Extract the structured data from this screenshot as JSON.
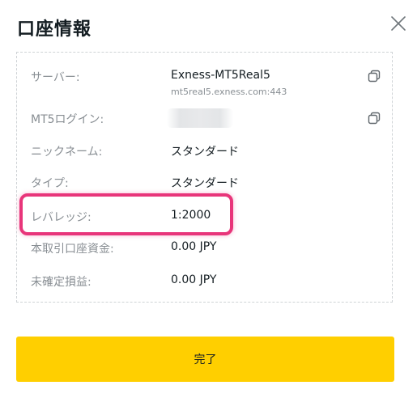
{
  "dialog": {
    "title": "口座情報",
    "close_icon": "close-icon"
  },
  "rows": [
    {
      "label": "サーバー:",
      "value": "Exness-MT5Real5",
      "sub": "mt5real5.exness.com:443",
      "copy_icon": "copy-icon"
    },
    {
      "label": "MT5ログイン:",
      "value": "",
      "blurred": true,
      "copy_icon": "copy-icon"
    },
    {
      "label": "ニックネーム:",
      "value": "スタンダード"
    },
    {
      "label": "タイプ:",
      "value": "スタンダード"
    },
    {
      "label": "レバレッジ:",
      "value": "1:2000",
      "highlighted": true
    },
    {
      "label": "本取引口座資金:",
      "value": "0.00 JPY"
    },
    {
      "label": "未確定損益:",
      "value": "0.00 JPY"
    }
  ],
  "footer": {
    "done_label": "完了"
  },
  "colors": {
    "accent_button": "#ffcf00",
    "highlight_border": "#e8357a",
    "label_text": "#888e93",
    "value_text": "#141d22"
  }
}
